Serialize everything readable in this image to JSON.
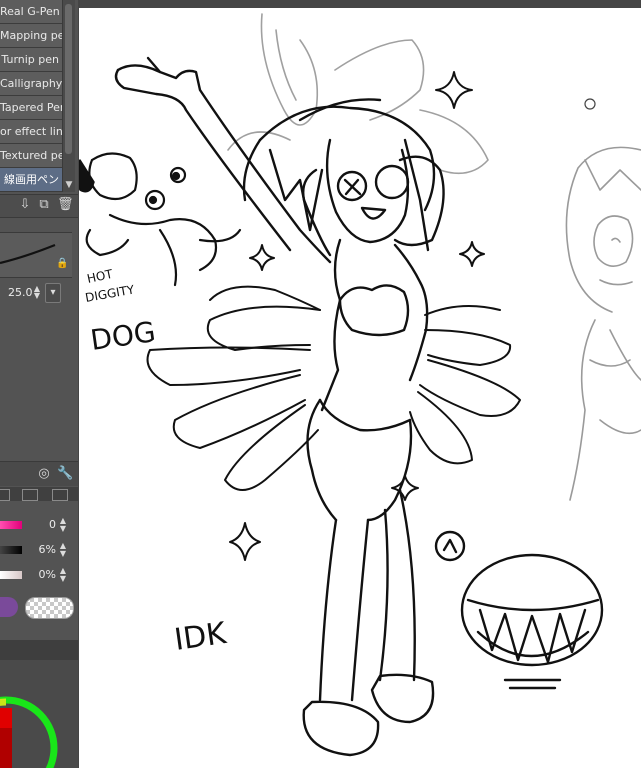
{
  "brush_list": {
    "items": [
      {
        "label": "Real G-Pen",
        "active": false
      },
      {
        "label": "Mapping pen",
        "active": false
      },
      {
        "label": "Turnip pen",
        "active": false
      },
      {
        "label": "Calligraphy",
        "active": false
      },
      {
        "label": "Tapered Pen",
        "active": false
      },
      {
        "label": "or effect line",
        "active": false
      },
      {
        "label": "Textured pen",
        "active": false
      },
      {
        "label": "線画用ペン",
        "active": true
      }
    ]
  },
  "brush_size": {
    "value": "25.0"
  },
  "color_sliders": [
    {
      "value": "0",
      "color": "#e2007a"
    },
    {
      "value": "6%",
      "color": "#111111"
    },
    {
      "value": "0%",
      "color": "#e8dcdc"
    }
  ],
  "colors": {
    "main_color": "#7a4a9a",
    "accent_panel": "#5d6d86",
    "canvas": "#ffffff"
  },
  "drawing_text": {
    "hot_diggity_dog": [
      "HOT",
      "DIGGITY",
      "DOG"
    ],
    "idk": "IDK"
  }
}
